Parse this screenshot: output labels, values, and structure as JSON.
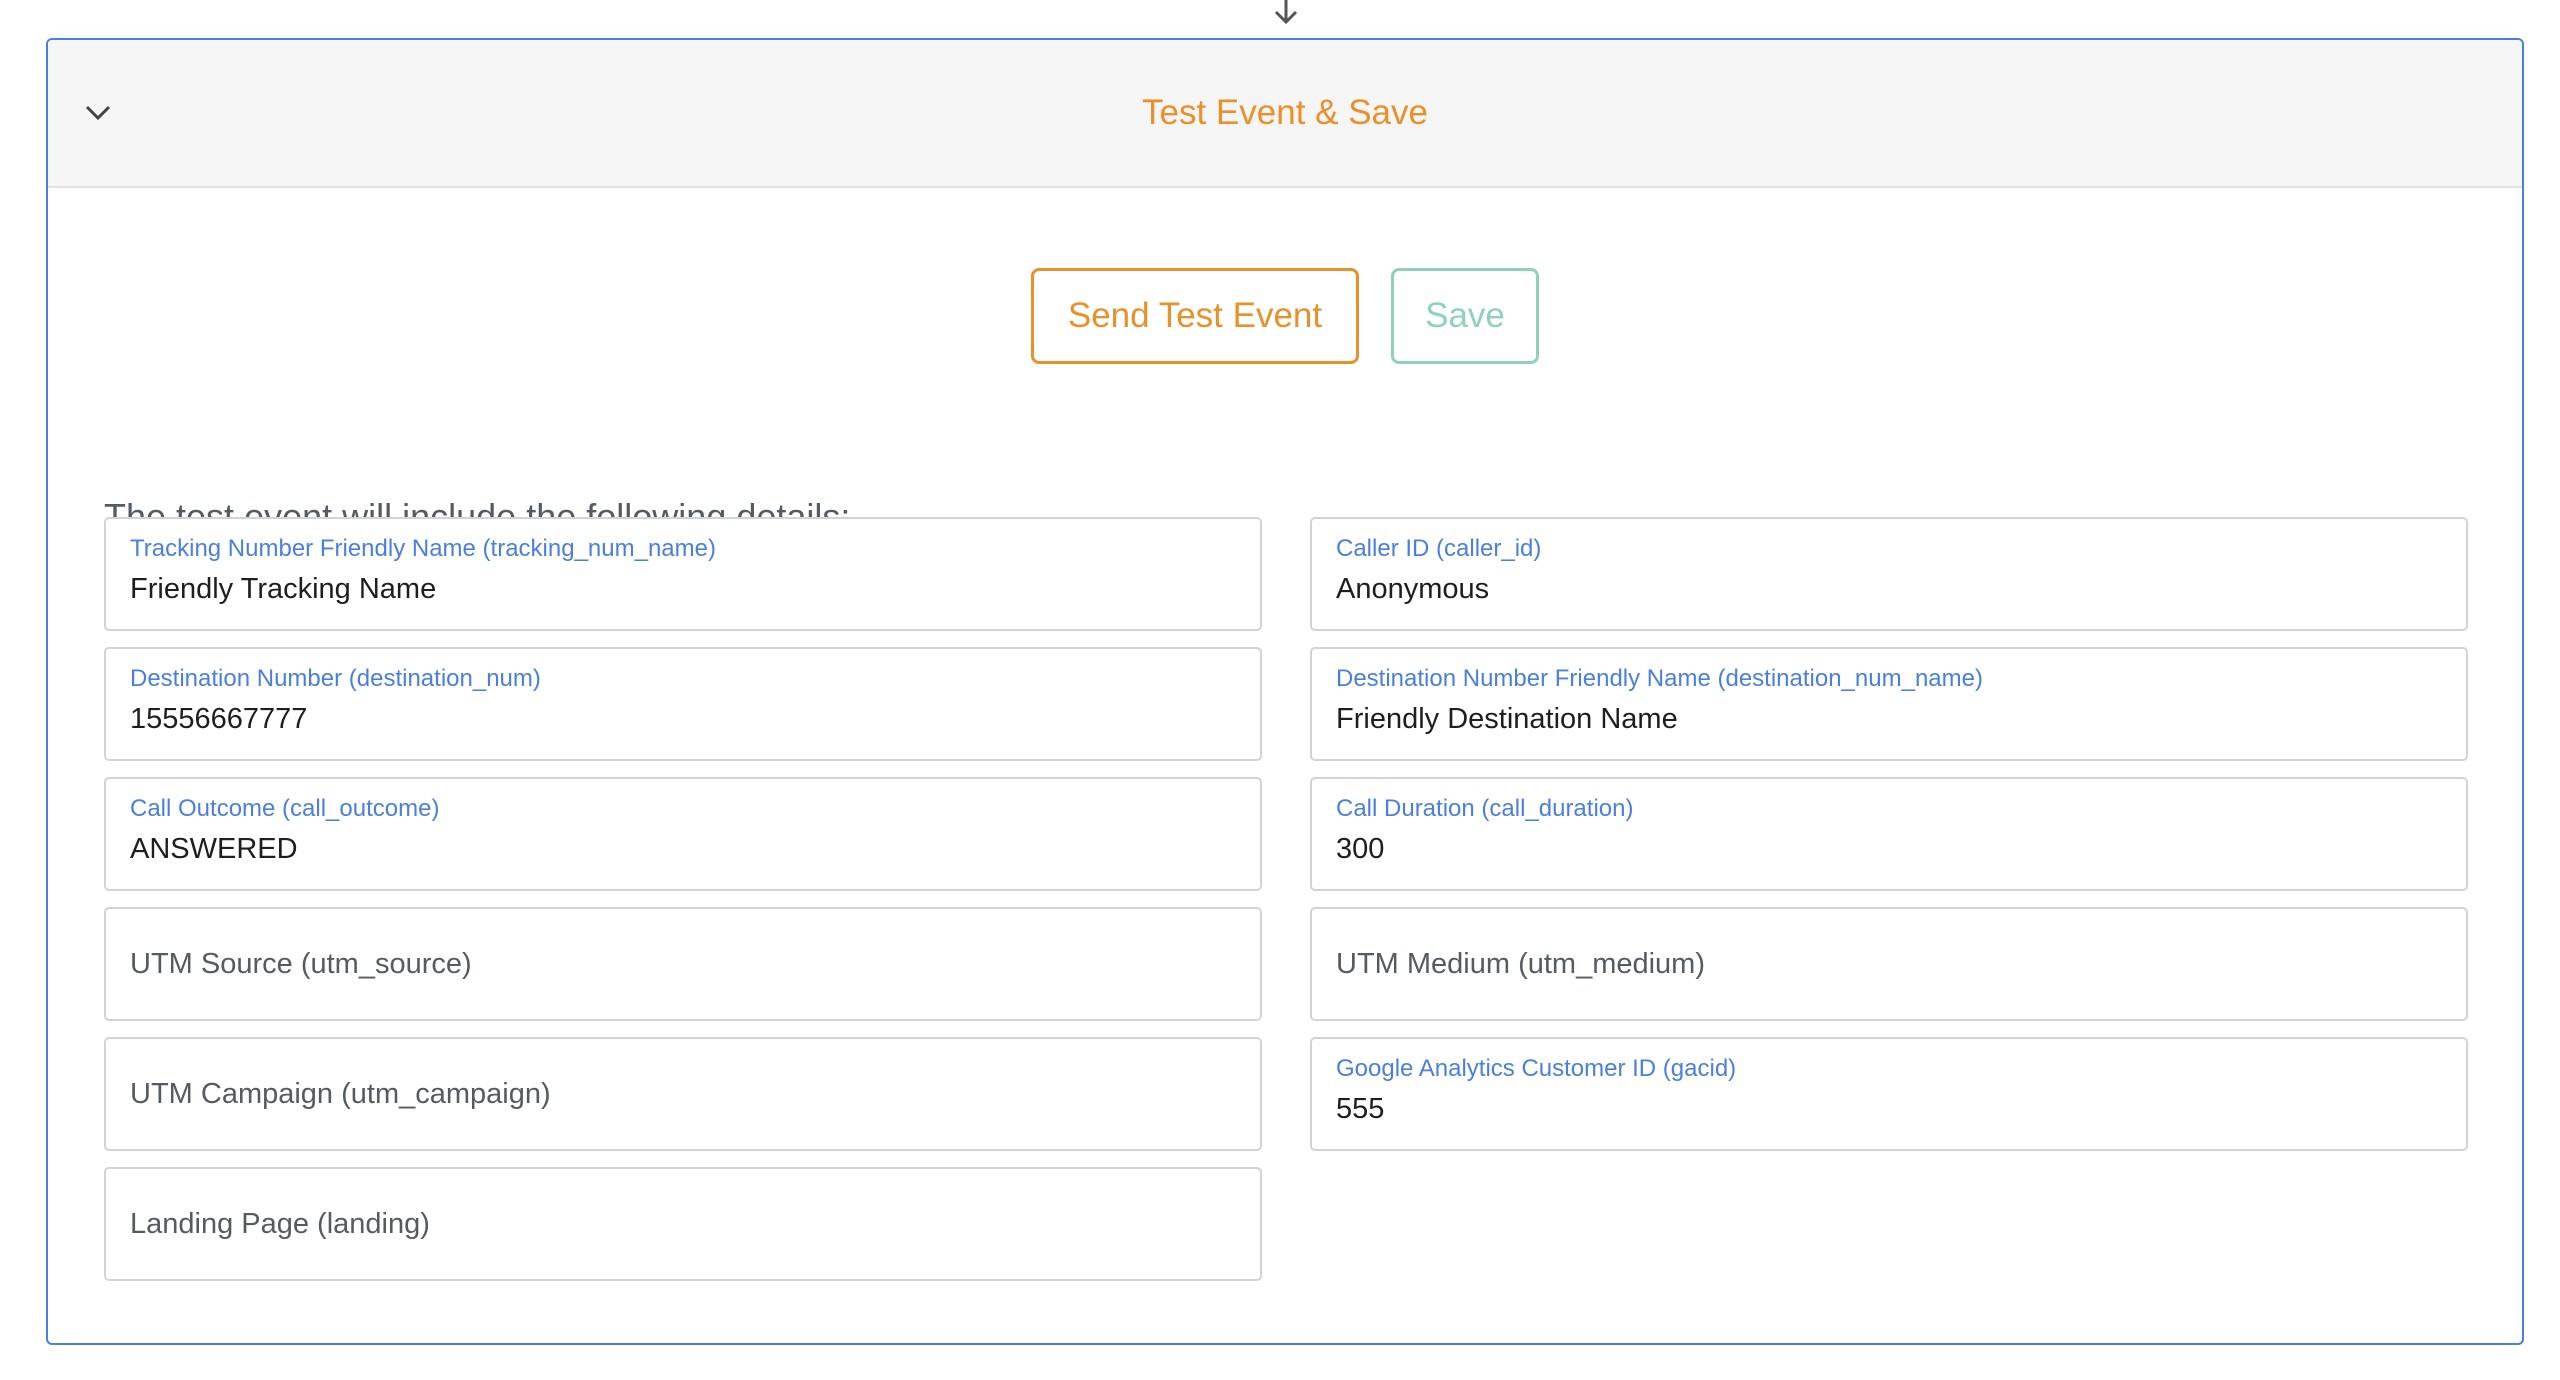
{
  "flow_arrow_icon": "arrow-down-icon",
  "panel": {
    "title": "Test Event & Save",
    "toggle_icon": "chevron-down-icon"
  },
  "actions": {
    "send_test_label": "Send Test Event",
    "save_label": "Save"
  },
  "details_heading": "The test event will include the following details:",
  "fields": {
    "tracking_num_name": {
      "label": "Tracking Number Friendly Name (tracking_num_name)",
      "value": "Friendly Tracking Name"
    },
    "caller_id": {
      "label": "Caller ID (caller_id)",
      "value": "Anonymous"
    },
    "destination_num": {
      "label": "Destination Number (destination_num)",
      "value": "15556667777"
    },
    "destination_num_name": {
      "label": "Destination Number Friendly Name (destination_num_name)",
      "value": "Friendly Destination Name"
    },
    "call_outcome": {
      "label": "Call Outcome (call_outcome)",
      "value": "ANSWERED"
    },
    "call_duration": {
      "label": "Call Duration (call_duration)",
      "value": "300"
    },
    "utm_source": {
      "placeholder": "UTM Source (utm_source)",
      "value": ""
    },
    "utm_medium": {
      "placeholder": "UTM Medium (utm_medium)",
      "value": ""
    },
    "utm_campaign": {
      "placeholder": "UTM Campaign (utm_campaign)",
      "value": ""
    },
    "gacid": {
      "label": "Google Analytics Customer ID (gacid)",
      "value": "555"
    },
    "landing": {
      "placeholder": "Landing Page (landing)",
      "value": ""
    }
  },
  "colors": {
    "accent_orange": "#e8902a",
    "accent_blue": "#4a7fe0",
    "save_green": "#8fd1bc"
  }
}
